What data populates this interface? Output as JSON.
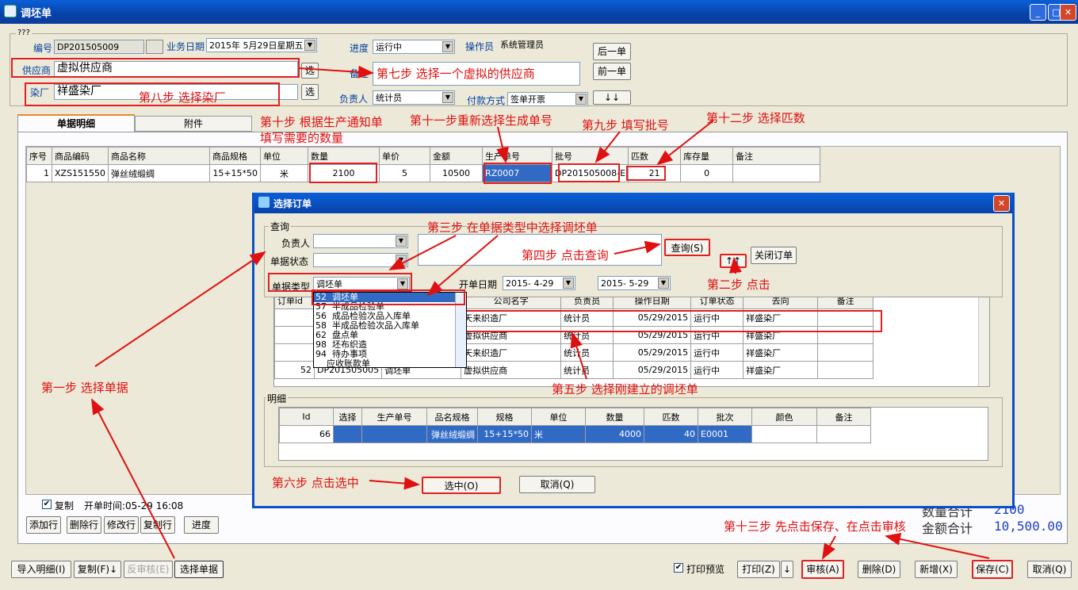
{
  "window": {
    "title": "调坯单"
  },
  "header": {
    "group_title": "???",
    "no_label": "编号",
    "no_value": "DP201505009",
    "date_label": "业务日期",
    "date_value": "2015年 5月29日星期五",
    "supplier_label": "供应商",
    "supplier_value": "虚拟供应商",
    "select_btn": "选",
    "dyehouse_label": "染厂",
    "dyehouse_value": "祥盛染厂",
    "select_btn2": "选",
    "progress_label": "进度",
    "progress_value": "运行中",
    "operator_label": "操作员",
    "operator_value": "系统管理员",
    "remark_label": "备注",
    "owner_label": "负责人",
    "owner_value": "统计员",
    "pay_label": "付款方式",
    "pay_value": "签单开票",
    "next_btn": "后一单",
    "prev_btn": "前一单",
    "down_btn": "↓↓"
  },
  "tabs": [
    "单据明细",
    "附件"
  ],
  "detail_table": {
    "headers": [
      "序号",
      "商品编码",
      "商品名称",
      "商品规格",
      "单位",
      "数量",
      "单价",
      "金额",
      "生产单号",
      "批号",
      "匹数",
      "库存量",
      "备注"
    ],
    "rows": [
      [
        "1",
        "XZS151550",
        "弹丝绒缎绸",
        "15+15*50",
        "米",
        "2100",
        "5",
        "10500",
        "RZ0007",
        "DP201505008-E",
        "21",
        "0",
        ""
      ]
    ]
  },
  "bottom": {
    "copy_label": "复制",
    "open_time": "开单时间:05-29 16:08",
    "buttons": [
      "添加行",
      "删除行",
      "修改行",
      "复制行",
      "进度"
    ],
    "qty_total_label": "数量合计",
    "qty_total": "2100",
    "amt_total_label": "金额合计",
    "amt_total": "10,500.00",
    "print_preview": "打印预览",
    "actions": [
      "导入明细(I)",
      "复制(F)↓",
      "反审核(E)",
      "选择单据"
    ],
    "right_actions": [
      "打印(Z)",
      "↓",
      "审核(A)",
      "删除(D)",
      "新增(X)",
      "保存(C)",
      "取消(Q)"
    ]
  },
  "dialog": {
    "title": "选择订单",
    "query_group": "查询",
    "owner_label": "负责人",
    "status_label": "单据状态",
    "type_label": "单据类型",
    "type_value": "调坯单",
    "open_date_label": "开单日期",
    "date_from": "2015- 4-29",
    "date_to": "2015- 5-29",
    "query_btn": "查询(S)",
    "arrows_btn": "↑↑",
    "close_order_btn": "关闭订单",
    "dropdown": [
      "52  调坯单",
      "57  半成品检验单",
      "56  成品检验次品入库单",
      "58  半成品检验次品入库单",
      "62  盘点单",
      "98  坯布织造",
      "94  待办事项",
      "    应收账款单"
    ],
    "orders_headers": [
      "订单id",
      "",
      "",
      "公司名字",
      "负责员",
      "操作日期",
      "订单状态",
      "去向",
      "备注"
    ],
    "orders": [
      [
        "",
        "",
        "",
        "天来织造厂",
        "统计员",
        "05/29/2015",
        "运行中",
        "祥盛染厂",
        ""
      ],
      [
        "",
        "",
        "",
        "虚拟供应商",
        "统计员",
        "05/29/2015",
        "运行中",
        "祥盛染厂",
        ""
      ],
      [
        "",
        "",
        "",
        "天来织造厂",
        "统计员",
        "05/29/2015",
        "运行中",
        "祥盛染厂",
        ""
      ],
      [
        "52",
        "DP201505005",
        "调坯单",
        "虚拟供应商",
        "统计员",
        "05/29/2015",
        "运行中",
        "祥盛染厂",
        ""
      ]
    ],
    "detail_group": "明细",
    "detail_headers": [
      "Id",
      "选择",
      "生产单号",
      "品名规格",
      "规格",
      "单位",
      "数量",
      "匹数",
      "批次",
      "颜色",
      "备注"
    ],
    "detail_rows": [
      [
        "66",
        "",
        "",
        "弹丝绒缎绸",
        "15+15*50",
        "米",
        "4000",
        "40",
        "E0001",
        "",
        ""
      ]
    ],
    "select_btn": "选中(O)",
    "cancel_btn": "取消(Q)"
  },
  "annotations": {
    "s1": "第一步 选择单据",
    "s2": "第二步 点击",
    "s3": "第三步 在单据类型中选择调坯单",
    "s4": "第四步 点击查询",
    "s5": "第五步 选择刚建立的调坯单",
    "s6": "第六步 点击选中",
    "s7": "第七步 选择一个虚拟的供应商",
    "s8": "第八步 选择染厂",
    "s9": "第九步 填写批号",
    "s10a": "第十步 根据生产通知单",
    "s10b": "填写需要的数量",
    "s11": "第十一步重新选择生成单号",
    "s12": "第十二步 选择匹数",
    "s13": "第十三步 先点击保存、在点击审核"
  }
}
